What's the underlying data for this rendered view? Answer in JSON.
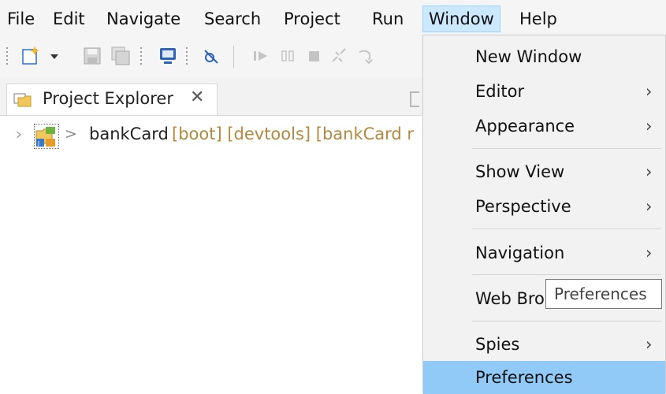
{
  "menubar": {
    "items": [
      {
        "label": "File"
      },
      {
        "label": "Edit"
      },
      {
        "label": "Navigate"
      },
      {
        "label": "Search"
      },
      {
        "label": "Project"
      },
      {
        "label": "Run"
      },
      {
        "label": "Window"
      },
      {
        "label": "Help"
      }
    ],
    "active": "Window"
  },
  "toolbar": {
    "icons": [
      "new-icon",
      "dropdown-arrow-icon",
      "save-icon",
      "save-all-icon",
      "terminal-icon",
      "skip-breakpoints-icon",
      "resume-icon",
      "suspend-icon",
      "terminate-icon",
      "disconnect-icon",
      "step-into-icon"
    ]
  },
  "explorer": {
    "tab_label": "Project Explorer",
    "close_glyph": "✕",
    "project": {
      "twisty": "›",
      "prefix": ">",
      "name": "bankCard",
      "decorations": "[boot] [devtools] [bankCard r"
    }
  },
  "window_menu": {
    "items": [
      {
        "label": "New Window",
        "submenu": false
      },
      {
        "label": "Editor",
        "submenu": true
      },
      {
        "label": "Appearance",
        "submenu": true
      },
      {
        "label": "Show View",
        "submenu": true
      },
      {
        "label": "Perspective",
        "submenu": true
      },
      {
        "label": "Navigation",
        "submenu": true
      },
      {
        "label": "Web Bro",
        "submenu": false
      },
      {
        "label": "Spies",
        "submenu": true
      },
      {
        "label": "Preferences",
        "submenu": false,
        "highlighted": true
      }
    ],
    "arrow_glyph": "›"
  },
  "tooltip": {
    "text": "Preferences"
  },
  "colors": {
    "menu_active_bg": "#cce8ff",
    "menu_highlight_bg": "#91c9f7",
    "decoration_text": "#b08a3e"
  }
}
